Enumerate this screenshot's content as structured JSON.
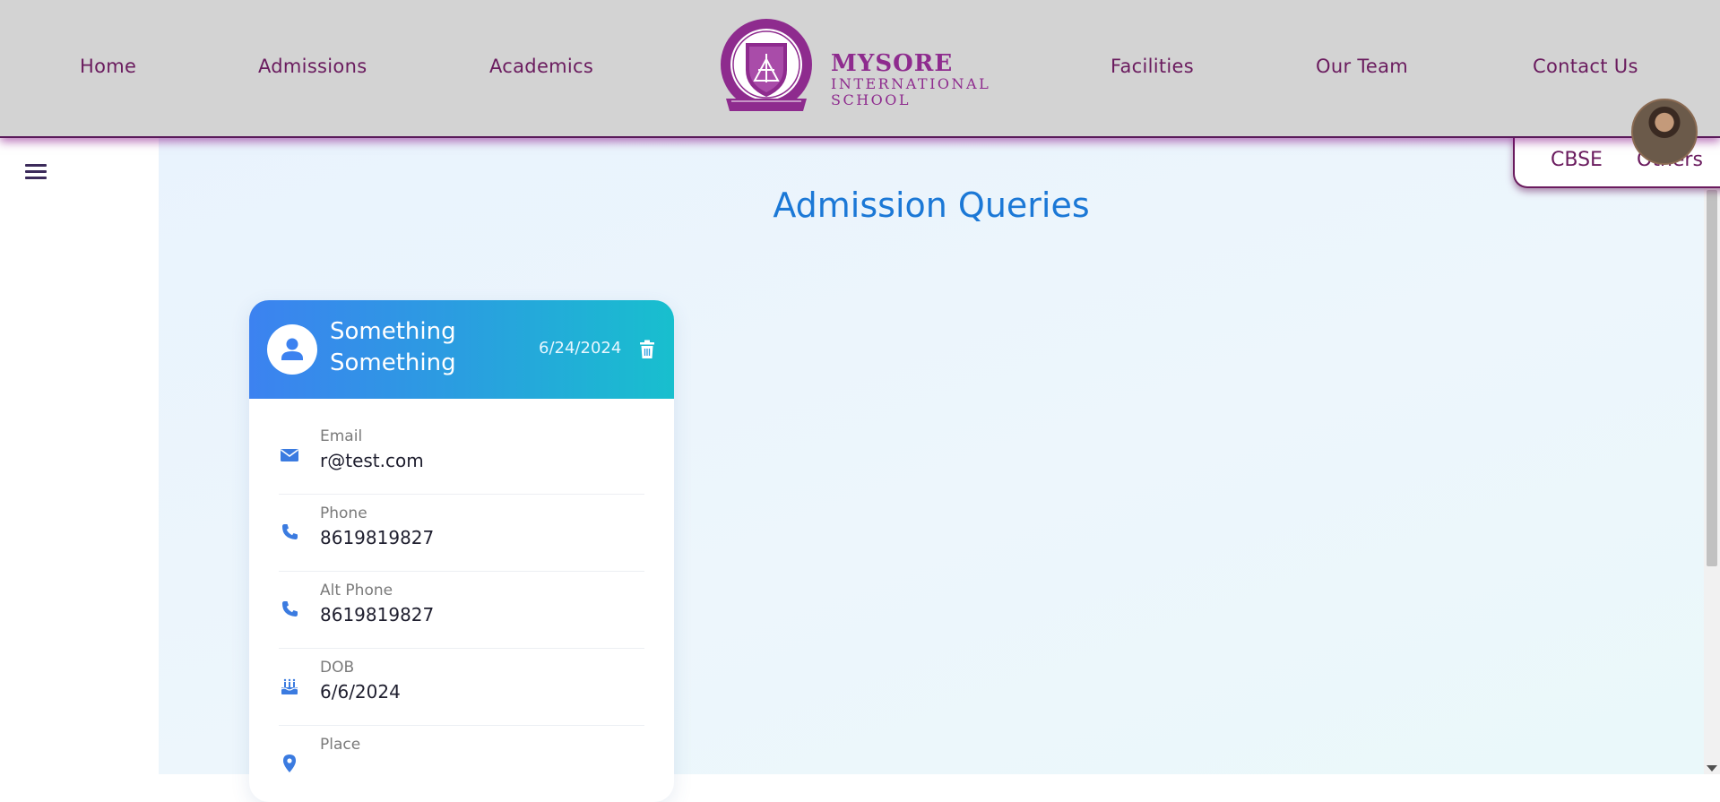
{
  "nav": {
    "left": [
      "Home",
      "Admissions",
      "Academics"
    ],
    "right": [
      "Facilities",
      "Our Team",
      "Contact Us"
    ]
  },
  "logo": {
    "line1": "MYSORE",
    "line2": "INTERNATIONAL",
    "line3": "SCHOOL",
    "crest_top": "EMPOWER · EXCEL · EDUCATE",
    "crest_name": "MYSORE",
    "crest_bottom": "A TRUSTED EDUCATION",
    "brand_color": "#8e2b8e"
  },
  "tabs": [
    "CBSE",
    "Others"
  ],
  "page": {
    "title": "Admission Queries"
  },
  "card": {
    "name_line1": "Something",
    "name_line2": "Something",
    "date": "6/24/2024",
    "fields": [
      {
        "icon": "envelope-icon",
        "label": "Email",
        "value": "r@test.com"
      },
      {
        "icon": "phone-icon",
        "label": "Phone",
        "value": "8619819827"
      },
      {
        "icon": "phone-icon",
        "label": "Alt Phone",
        "value": "8619819827"
      },
      {
        "icon": "birthday-cake-icon",
        "label": "DOB",
        "value": "6/6/2024"
      },
      {
        "icon": "map-pin-icon",
        "label": "Place",
        "value": ""
      }
    ]
  },
  "colors": {
    "header_bg": "#d3d3d3",
    "nav_text": "#6a1b5e",
    "title_blue": "#1b78d6",
    "card_gradient_start": "#3c82f0",
    "card_gradient_end": "#18bfce",
    "icon_blue": "#3b7be0"
  }
}
